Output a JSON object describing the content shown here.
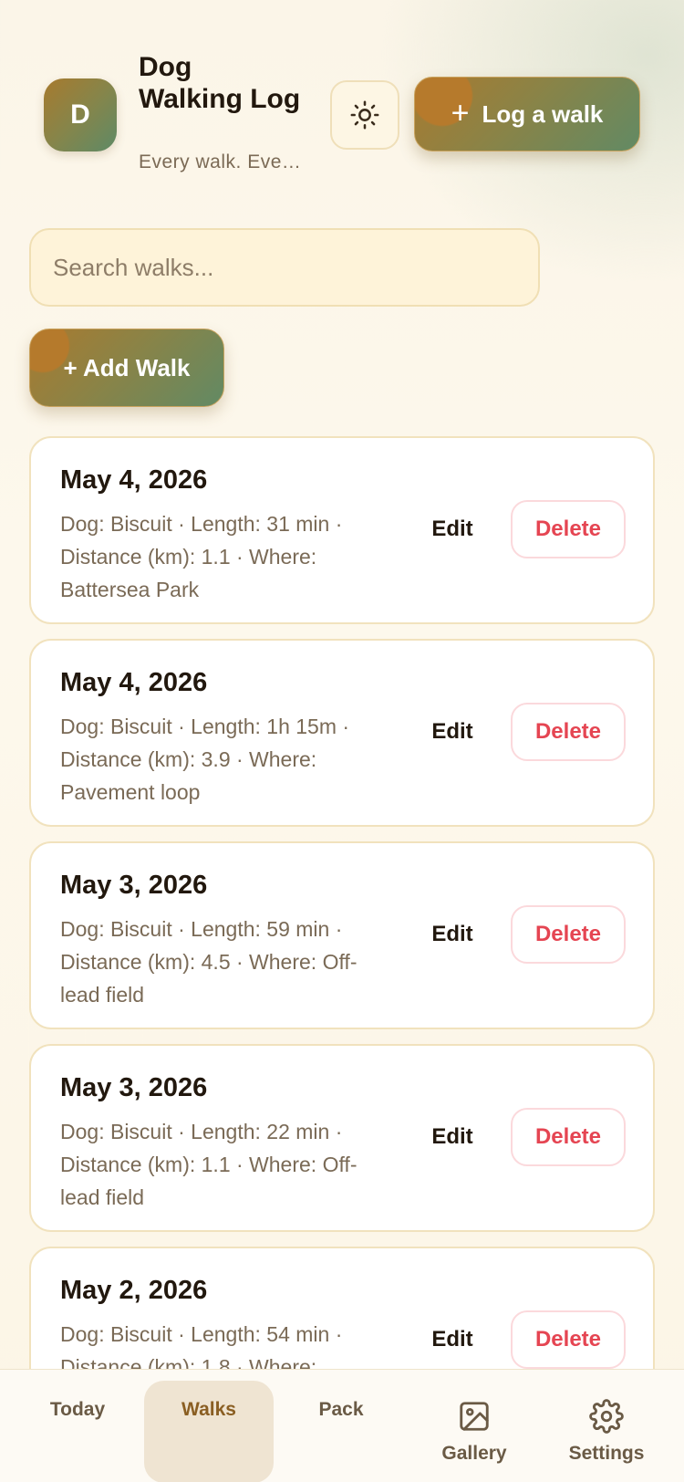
{
  "header": {
    "avatar_letter": "D",
    "title": "Dog Walking Log",
    "subtitle": "Every walk. Every dog.",
    "theme_icon": "sun-icon",
    "log_button_label": "Log a walk"
  },
  "search": {
    "placeholder": "Search walks..."
  },
  "add_walk_label": "+ Add Walk",
  "walks": [
    {
      "date": "May 4, 2026",
      "details": "Dog: Biscuit · Length: 31 min · Distance (km): 1.1 · Where: Battersea Park",
      "edit": "Edit",
      "delete": "Delete"
    },
    {
      "date": "May 4, 2026",
      "details": "Dog: Biscuit · Length: 1h 15m · Distance (km): 3.9 · Where: Pavement loop",
      "edit": "Edit",
      "delete": "Delete"
    },
    {
      "date": "May 3, 2026",
      "details": "Dog: Biscuit · Length: 59 min · Distance (km): 4.5 · Where: Off-lead field",
      "edit": "Edit",
      "delete": "Delete"
    },
    {
      "date": "May 3, 2026",
      "details": "Dog: Biscuit · Length: 22 min · Distance (km): 1.1 · Where: Off-lead field",
      "edit": "Edit",
      "delete": "Delete"
    },
    {
      "date": "May 2, 2026",
      "details": "Dog: Biscuit · Length: 54 min · Distance (km): 1.8 · Where:",
      "edit": "Edit",
      "delete": "Delete"
    }
  ],
  "tabs": [
    {
      "label": "Today"
    },
    {
      "label": "Walks",
      "active": true
    },
    {
      "label": "Pack"
    },
    {
      "label": "Gallery",
      "icon": "image-icon"
    },
    {
      "label": "Settings",
      "icon": "gear-icon"
    }
  ],
  "colors": {
    "accent_start": "#a97a2f",
    "accent_end": "#628a64",
    "danger": "#e54552",
    "active_tab_bg": "#efe4d2"
  }
}
